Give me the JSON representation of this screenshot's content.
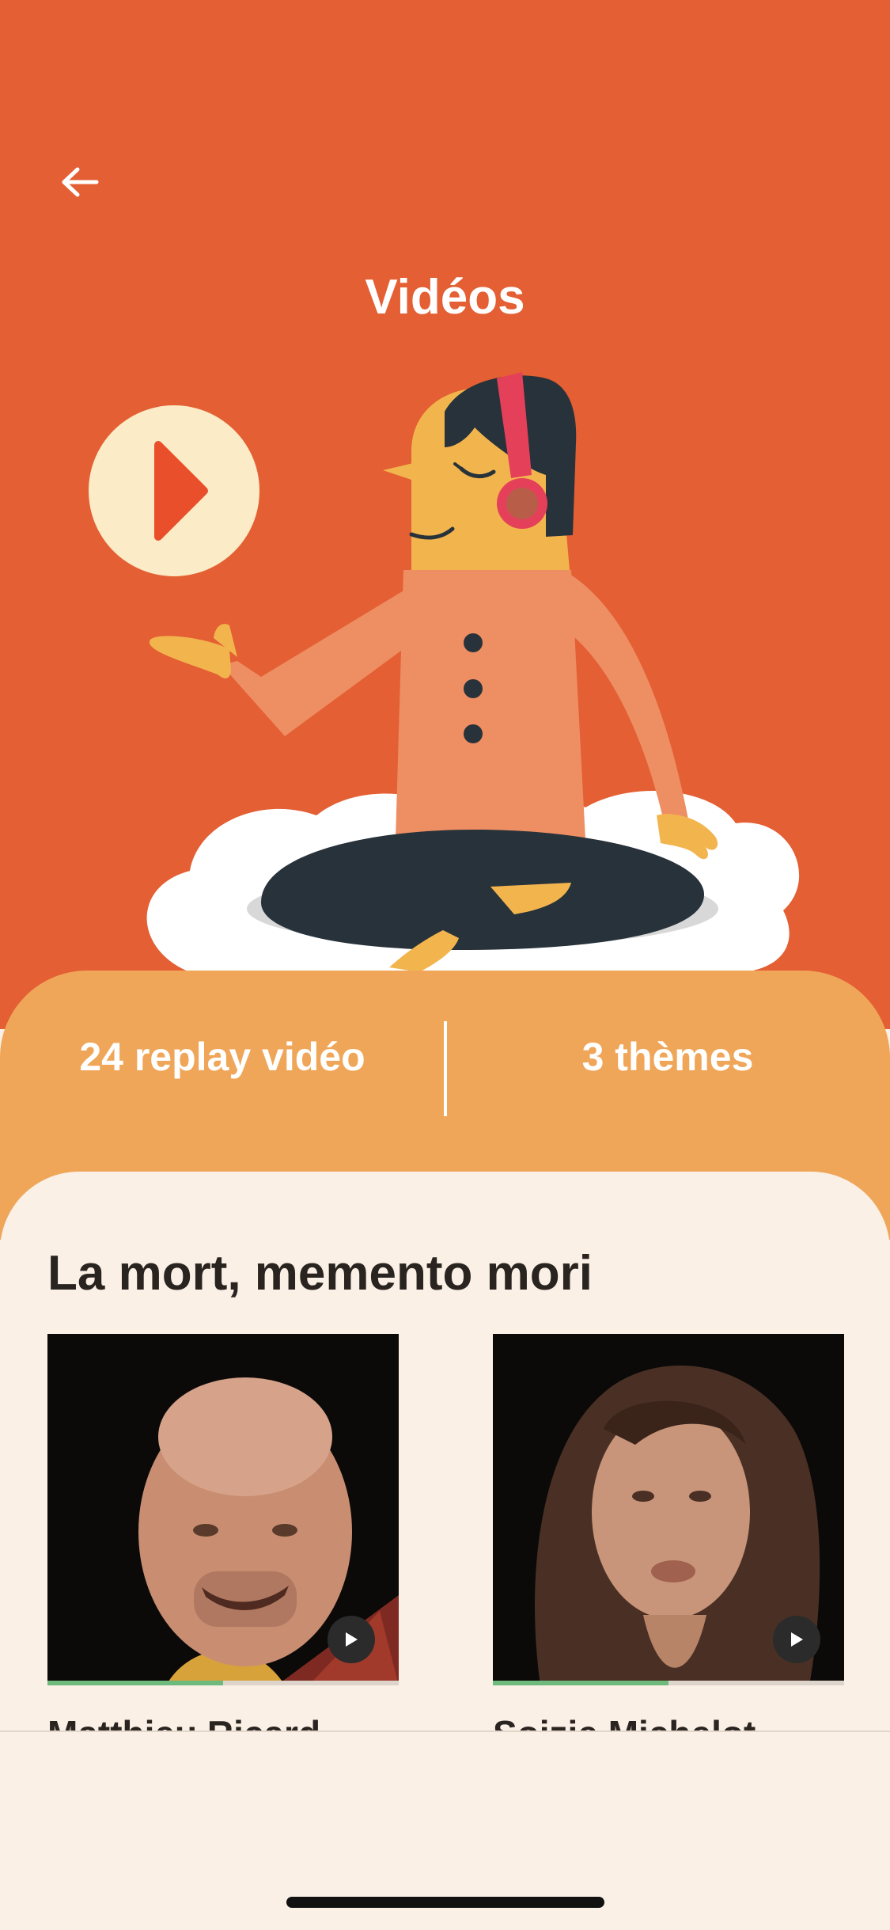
{
  "header": {
    "title": "Vidéos",
    "back_icon": "arrow-left-icon"
  },
  "stats": {
    "replays": "24 replay vidéo",
    "themes": "3 thèmes"
  },
  "section": {
    "title": "La mort, memento mori",
    "videos": [
      {
        "name": "Matthieu Ricard",
        "progress": 0.5
      },
      {
        "name": "Sojzie Michelot",
        "progress": 0.5
      }
    ]
  },
  "colors": {
    "hero_background": "#E45F33",
    "stats_background": "#EFA659",
    "content_background": "#FAF0E6",
    "progress": "#6EB97C"
  }
}
